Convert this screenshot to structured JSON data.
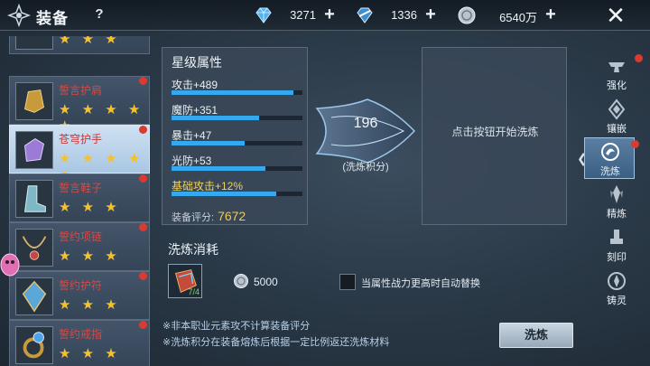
{
  "header": {
    "title": "装备",
    "help": "?",
    "currencies": [
      {
        "icon": "diamond-icon",
        "value": "3271"
      },
      {
        "icon": "bound-diamond-icon",
        "value": "1336"
      },
      {
        "icon": "silver-coin-icon",
        "value": "6540万"
      }
    ],
    "plus": "+",
    "close": "✕"
  },
  "equipment_list": [
    {
      "name": "",
      "stars": "★ ★ ★",
      "dot": false
    },
    {
      "name": "誓言护肩",
      "stars": "★ ★ ★ ★ ★",
      "dot": true
    },
    {
      "name": "苍穹护手",
      "stars": "★ ★ ★ ★ ★",
      "dot": true,
      "selected": true
    },
    {
      "name": "誓言鞋子",
      "stars": "★ ★ ★",
      "dot": true
    },
    {
      "name": "誓约项链",
      "stars": "★ ★ ★",
      "dot": true
    },
    {
      "name": "誓约护符",
      "stars": "★ ★ ★",
      "dot": true
    },
    {
      "name": "誓约戒指",
      "stars": "★ ★ ★",
      "dot": true
    }
  ],
  "star_attributes": {
    "title": "星级属性",
    "items": [
      {
        "text": "攻击+489",
        "fill": 0.93,
        "gold": false
      },
      {
        "text": "魔防+351",
        "fill": 0.67,
        "gold": false
      },
      {
        "text": "暴击+47",
        "fill": 0.56,
        "gold": false
      },
      {
        "text": "光防+53",
        "fill": 0.72,
        "gold": false
      },
      {
        "text": "基础攻击+12%",
        "fill": 0.8,
        "gold": true
      }
    ],
    "score_label": "装备评分:",
    "score_value": "7672"
  },
  "refine_points": {
    "value": "196",
    "label": "(洗炼积分)"
  },
  "result_panel": {
    "message": "点击按钮开始洗炼"
  },
  "side_tabs": [
    {
      "label": "强化",
      "icon": "anvil-icon",
      "active": false,
      "dot": true
    },
    {
      "label": "镶嵌",
      "icon": "gem-socket-icon",
      "active": false,
      "dot": false
    },
    {
      "label": "洗炼",
      "icon": "refine-swirl-icon",
      "active": true,
      "dot": true
    },
    {
      "label": "精炼",
      "icon": "crystal-icon",
      "active": false,
      "dot": false
    },
    {
      "label": "刻印",
      "icon": "seal-icon",
      "active": false,
      "dot": false
    },
    {
      "label": "铸灵",
      "icon": "soul-icon",
      "active": false,
      "dot": false
    }
  ],
  "cost": {
    "title": "洗炼消耗",
    "material_count": "7/4",
    "coin_value": "5000",
    "auto_replace_label": "当属性战力更高时自动替换"
  },
  "notes": [
    "※非本职业元素攻不计算装备评分",
    "※洗炼积分在装备熔炼后根据一定比例返还洗炼材料"
  ],
  "refine_button": "洗炼",
  "colors": {
    "bar": "#35a9ef",
    "gold_text": "#f0d35a",
    "red_dot": "#d93b30",
    "item_name": "#d44a44"
  }
}
